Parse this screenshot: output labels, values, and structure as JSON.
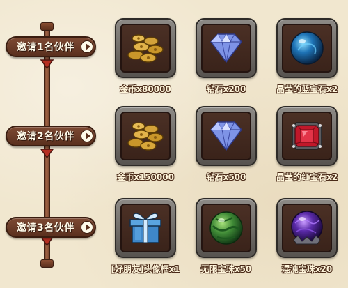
{
  "tiers": [
    {
      "label": "邀请1名伙伴",
      "rewards": [
        {
          "icon": "gold-coins-icon",
          "caption": "金币x80000"
        },
        {
          "icon": "diamond-icon",
          "caption": "钻石x200"
        },
        {
          "icon": "blue-gem-orb-icon",
          "caption": "晶莹的蓝宝石x2"
        }
      ]
    },
    {
      "label": "邀请2名伙伴",
      "rewards": [
        {
          "icon": "gold-coins-icon",
          "caption": "金币x150000"
        },
        {
          "icon": "diamond-icon",
          "caption": "钻石x500"
        },
        {
          "icon": "red-gem-icon",
          "caption": "晶莹的红宝石x2"
        }
      ]
    },
    {
      "label": "邀请3名伙伴",
      "rewards": [
        {
          "icon": "gift-box-icon",
          "caption": "[好朋友]头像框x1"
        },
        {
          "icon": "green-orb-icon",
          "caption": "无限宝珠x50"
        },
        {
          "icon": "purple-orb-icon",
          "caption": "混沌宝珠x20"
        }
      ]
    }
  ]
}
